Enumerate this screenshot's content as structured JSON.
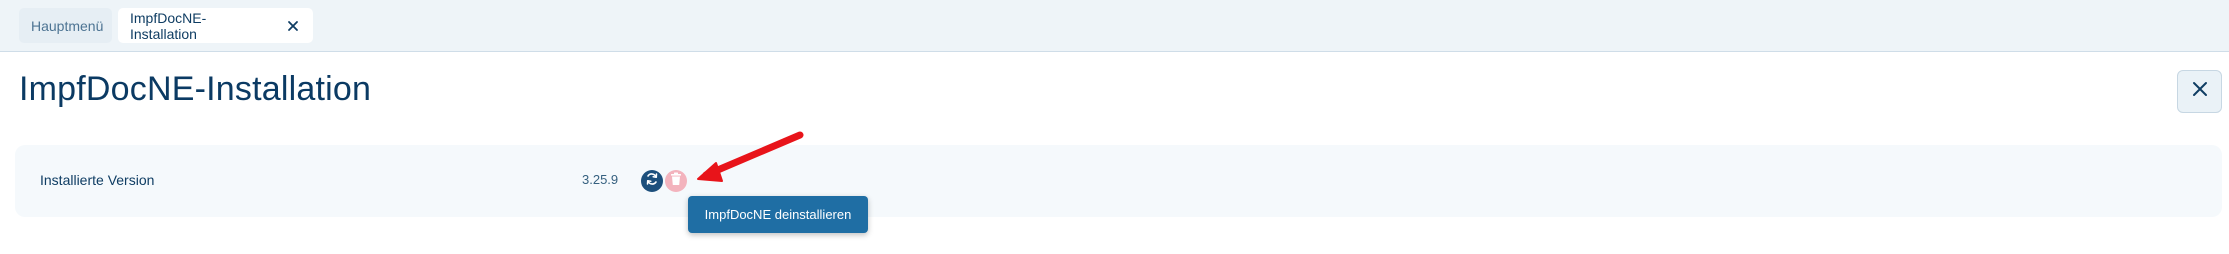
{
  "tabs": {
    "main_label": "Hauptmenü",
    "active_label": "ImpfDocNE-Installation",
    "close_icon": "close-icon"
  },
  "page": {
    "title": "ImpfDocNE-Installation",
    "close_icon": "close-icon"
  },
  "version_row": {
    "label": "Installierte Version",
    "value": "3.25.9",
    "actions": [
      {
        "name": "reinstall",
        "icon": "refresh-icon",
        "color": "#1c4f7c"
      },
      {
        "name": "uninstall",
        "icon": "trash-icon",
        "color": "#f3b3bd"
      }
    ]
  },
  "tooltip": {
    "text": "ImpfDocNE deinstallieren",
    "color": "#1f6ea4"
  },
  "annotation": {
    "arrow_color": "#e8141a"
  }
}
